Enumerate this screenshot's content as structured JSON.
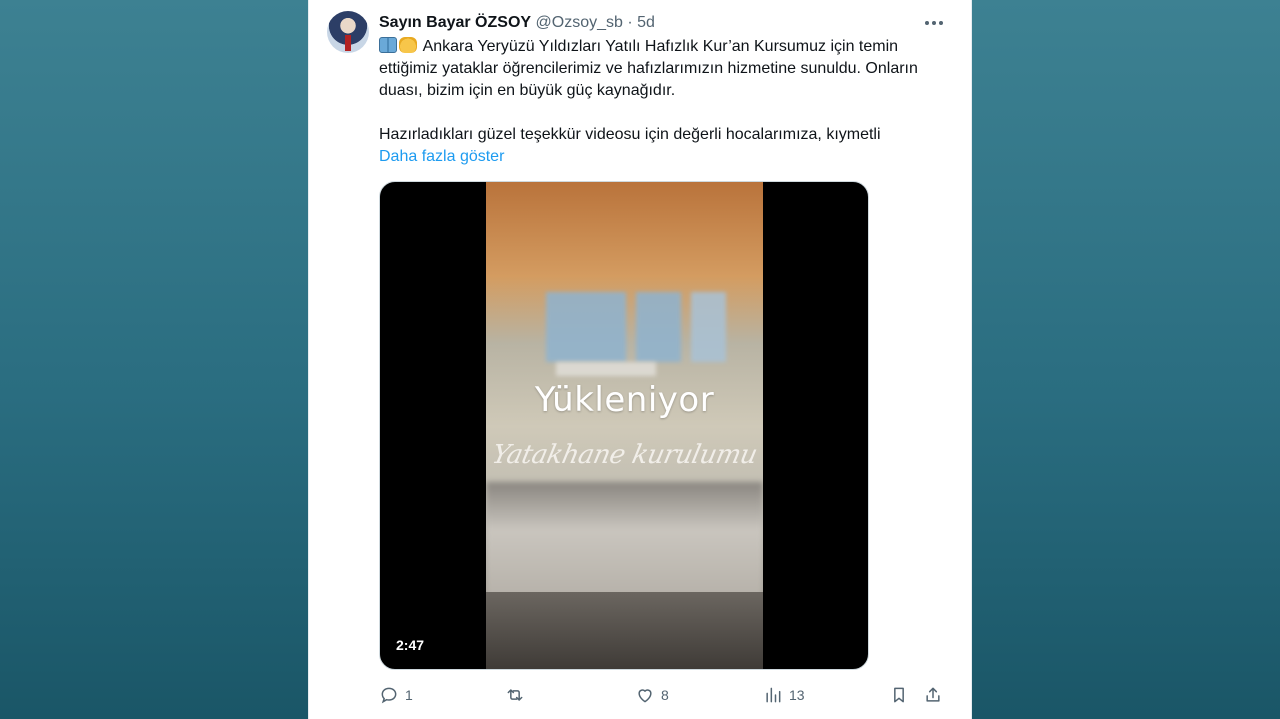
{
  "tweet": {
    "author_name": "Sayın Bayar ÖZSOY",
    "handle": "@Ozsoy_sb",
    "separator": "·",
    "time": "5d",
    "paragraph1": "Ankara Yeryüzü Yıldızları Yatılı Hafızlık Kur’an Kursumuz için temin ettiğimiz yataklar öğrencilerimiz ve hafızlarımızın hizmetine sunuldu. Onların duası, bizim için en büyük güç kaynağıdır.",
    "paragraph2": "Hazırladıkları güzel teşekkür videosu için değerli hocalarımıza, kıymetli",
    "show_more": "Daha fazla göster"
  },
  "media": {
    "loading_label": "Yükleniyor",
    "overlay_caption": "Yatakhane kurulumu",
    "duration": "2:47"
  },
  "actions": {
    "replies": "1",
    "retweets": "",
    "likes": "8",
    "views": "13"
  },
  "colors": {
    "link": "#1d9bf0",
    "muted": "#536471",
    "text": "#0f1419"
  },
  "icons": [
    "open-book-emoji",
    "raising-hands-emoji",
    "more-icon",
    "reply-icon",
    "retweet-icon",
    "like-icon",
    "views-icon",
    "bookmark-icon",
    "share-icon"
  ]
}
